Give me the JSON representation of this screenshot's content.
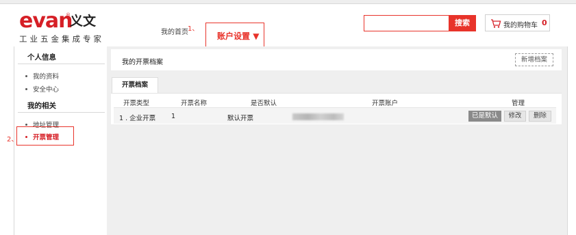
{
  "header": {
    "logo_word": "evan",
    "logo_registered": "®",
    "logo_cn": "义文",
    "logo_slogan": "工业五金集成专家",
    "my_home": "我的首页",
    "annotation_1": "1、",
    "account_settings": "账户设置",
    "account_arrow": "▼",
    "search_value": "",
    "search_button": "搜索",
    "cart_label": "我的购物车",
    "cart_count": "0"
  },
  "sidebar": {
    "section1_title": "个人信息",
    "section1_items": [
      "我的资料",
      "安全中心"
    ],
    "section2_title": "我的相关",
    "section2_items": [
      "地址管理",
      "开票管理"
    ],
    "active_item": "开票管理",
    "annotation_2": "2、"
  },
  "panel": {
    "title": "我的开票档案",
    "new_button": "新增档案",
    "tab": "开票档案"
  },
  "table": {
    "headers": [
      "开票类型",
      "开票名称",
      "是否默认",
      "开票账户",
      "管理"
    ],
    "rows": [
      {
        "type": "1 . 企业开票",
        "name": "1",
        "is_default": "默认开票",
        "account": "",
        "btn_default": "已是默认",
        "btn_edit": "修改",
        "btn_delete": "删除"
      }
    ]
  },
  "colors": {
    "brand_red": "#d61f26",
    "highlight_red": "#e8332a",
    "content_bg": "#efefef"
  },
  "icons": [
    "cart-icon"
  ]
}
